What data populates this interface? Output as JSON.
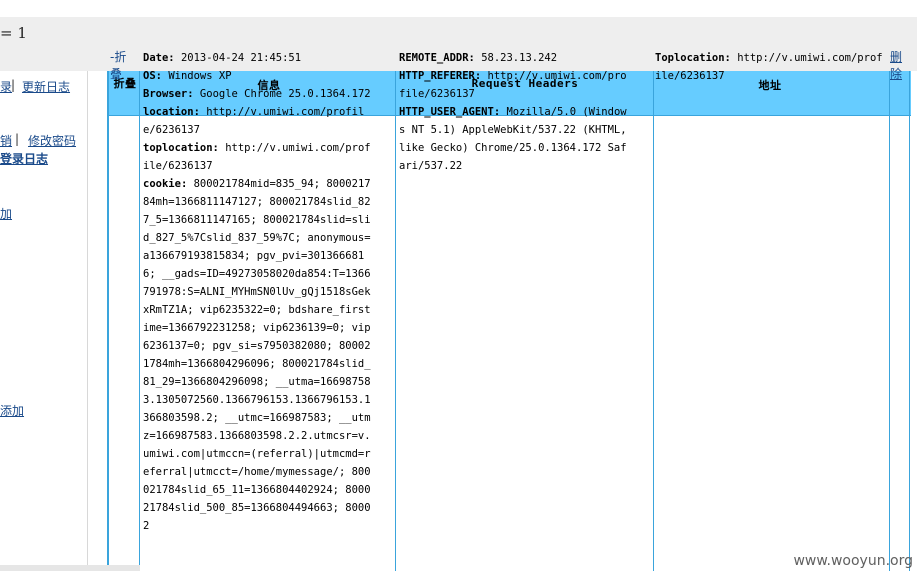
{
  "header": {
    "page_count_text": "= 1"
  },
  "sidebar": {
    "partial_link_1": "录",
    "separator": "|",
    "changelog": "更新日志",
    "logout_partial": "销",
    "separator2": "|",
    "change_password": "修改密码",
    "login_log_partial": "登录日志",
    "add_partial_1": "加",
    "add_partial_2": "添加"
  },
  "table": {
    "headers": {
      "fold": "折叠",
      "info": "信息",
      "request_headers": "Request Headers",
      "address": "地址"
    },
    "row": {
      "fold_link": "-折叠",
      "info": [
        {
          "label": "Date",
          "value": "2013-04-24 21:45:51"
        },
        {
          "label": "OS",
          "value": "Windows XP"
        },
        {
          "label": "Browser",
          "value": "Google Chrome 25.0.1364.172"
        },
        {
          "label": "location",
          "value": "http://v.umiwi.com/profile/6236137"
        },
        {
          "label": "toplocation",
          "value": "http://v.umiwi.com/profile/6236137"
        },
        {
          "label": "cookie",
          "value": "800021784mid=835_94; 800021784mh=1366811147127; 800021784slid_827_5=1366811147165; 800021784slid=slid_827_5%7Cslid_837_59%7C; anonymous=a136679193815834; pgv_pvi=3013666816; __gads=ID=49273058020da854:T=1366791978:S=ALNI_MYHmSN0lUv_gQj1518sGekxRmTZ1A; vip6235322=0; bdshare_firstime=1366792231258; vip6236139=0; vip6236137=0; pgv_si=s7950382080; 800021784mh=1366804296096; 800021784slid_81_29=1366804296098; __utma=166987583.1305072560.1366796153.1366796153.1366803598.2; __utmc=166987583; __utmz=166987583.1366803598.2.2.utmcsr=v.umiwi.com|utmccn=(referral)|utmcmd=referral|utmcct=/home/mymessage/; 800021784slid_65_11=1366804402924; 800021784slid_500_85=1366804494663; 80002"
        }
      ],
      "headers": [
        {
          "label": "REMOTE_ADDR",
          "value": "58.23.13.242"
        },
        {
          "label": "HTTP_REFERER",
          "value": "http://v.umiwi.com/profile/6236137"
        },
        {
          "label": "HTTP_USER_AGENT",
          "value": "Mozilla/5.0 (Windows NT 5.1) AppleWebKit/537.22 (KHTML, like Gecko) Chrome/25.0.1364.172 Safari/537.22"
        }
      ],
      "address": {
        "label": "Toplocation",
        "value": "http://v.umiwi.com/profile/6236137"
      },
      "delete_link": "删除"
    }
  },
  "watermark": "www.wooyun.org"
}
